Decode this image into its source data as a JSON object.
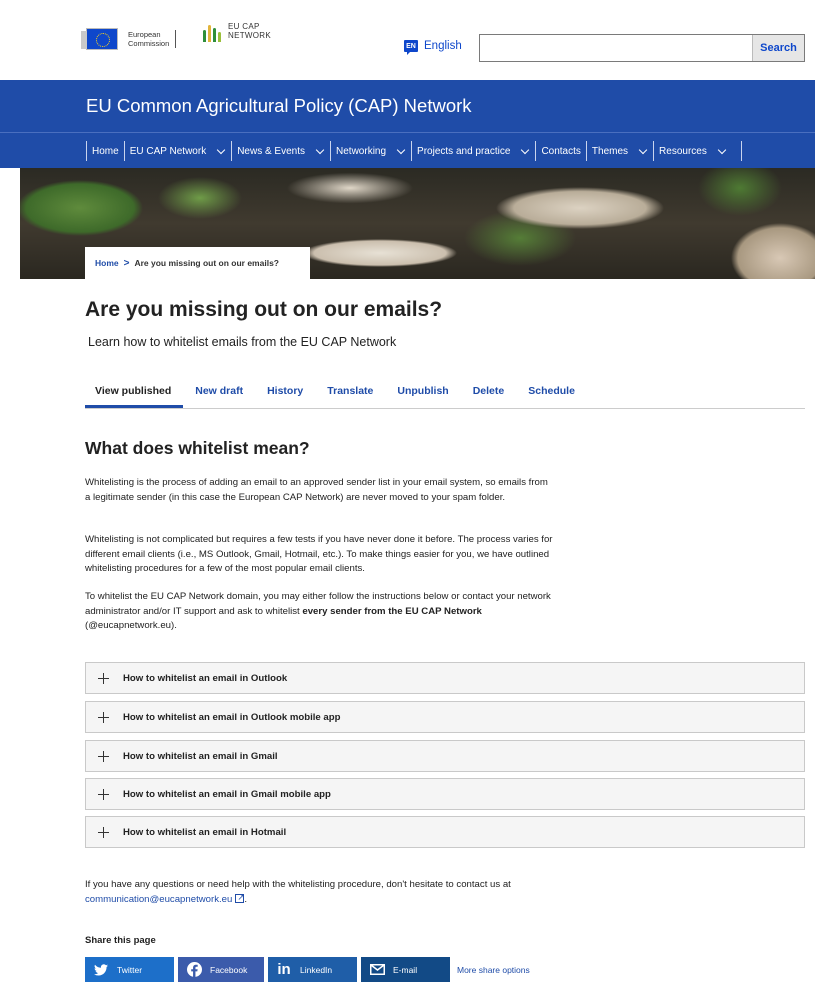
{
  "header": {
    "ec_logo_text": [
      "European",
      "Commission"
    ],
    "cap_logo_text": [
      "EU CAP",
      "NETWORK"
    ],
    "language_code": "EN",
    "language_label": "English",
    "search_value": "",
    "search_button": "Search"
  },
  "banner": {
    "site_title": "EU Common Agricultural Policy (CAP) Network",
    "nav": [
      {
        "label": "Home",
        "dropdown": false
      },
      {
        "label": "EU CAP Network",
        "dropdown": true
      },
      {
        "label": "News & Events",
        "dropdown": true
      },
      {
        "label": "Networking",
        "dropdown": true
      },
      {
        "label": "Projects and practice",
        "dropdown": true
      },
      {
        "label": "Contacts",
        "dropdown": false
      },
      {
        "label": "Themes",
        "dropdown": true
      },
      {
        "label": "Resources",
        "dropdown": true
      }
    ]
  },
  "breadcrumb": {
    "home": "Home",
    "separator": ">",
    "current": "Are you missing out on our emails?"
  },
  "page": {
    "title": "Are you missing out on our emails?",
    "subtitle": "Learn how to whitelist emails from the EU CAP Network",
    "tabs": [
      "View published",
      "New draft",
      "History",
      "Translate",
      "Unpublish",
      "Delete",
      "Schedule"
    ],
    "active_tab": "View published"
  },
  "content": {
    "heading": "What does whitelist mean?",
    "p1": "Whitelisting is the process of adding an email to an approved sender list in your email system, so emails from a legitimate sender (in this case the European CAP Network) are never moved to your spam folder.",
    "p2": "Whitelisting is not complicated but requires a few tests if you have never done it before. The process varies for different email clients (i.e., MS Outlook, Gmail, Hotmail, etc.). To make things easier for you, we have outlined whitelisting procedures for a few of the most popular email clients.",
    "p3_start": "To whitelist the EU CAP Network domain, you may either follow the instructions below or contact your network administrator and/or IT support and ask to whitelist ",
    "p3_bold": "every sender from the EU CAP Network",
    "p3_end": " (@eucapnetwork.eu).",
    "accordion": [
      "How to whitelist an email in Outlook",
      "How to whitelist an email in Outlook mobile app",
      "How to whitelist an email in Gmail",
      "How to whitelist an email in Gmail mobile app",
      "How to whitelist an email in Hotmail"
    ],
    "help_text": "If you have any questions or need help with the whitelisting procedure, don't hesitate to contact us at",
    "help_link": "communication@eucapnetwork.eu",
    "help_end": "."
  },
  "share": {
    "title": "Share this page",
    "buttons": [
      {
        "label": "Twitter",
        "icon": "twitter-icon"
      },
      {
        "label": "Facebook",
        "icon": "facebook-icon"
      },
      {
        "label": "LinkedIn",
        "icon": "linkedin-icon"
      },
      {
        "label": "E-mail",
        "icon": "email-icon"
      }
    ],
    "more": "More share options"
  }
}
